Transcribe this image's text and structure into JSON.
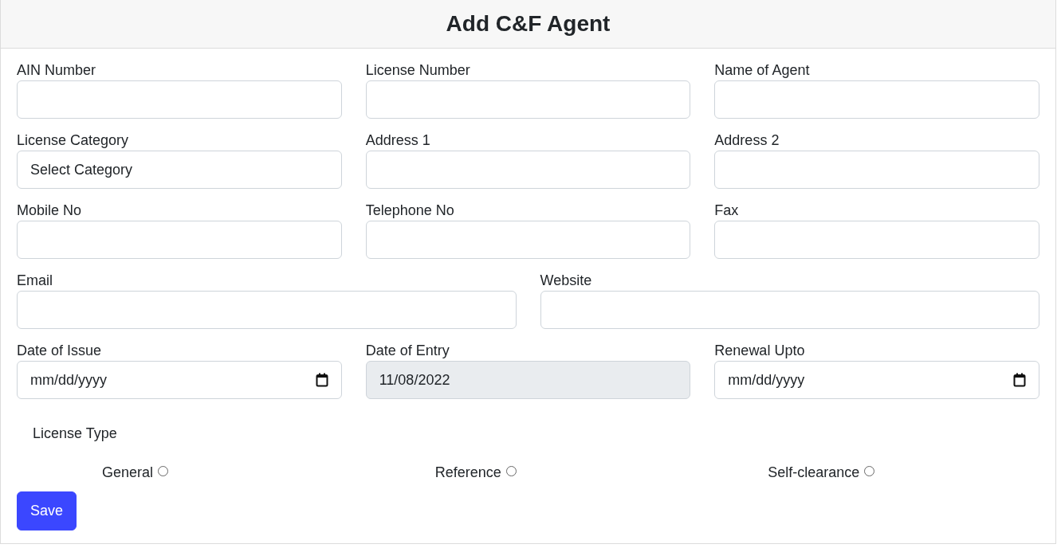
{
  "title": "Add C&F Agent",
  "rows": [
    {
      "fields": [
        {
          "kind": "text",
          "label": "AIN Number"
        },
        {
          "kind": "text",
          "label": "License Number"
        },
        {
          "kind": "text",
          "label": "Name of Agent"
        }
      ]
    },
    {
      "fields": [
        {
          "kind": "select",
          "label": "License Category",
          "value": "Select Category"
        },
        {
          "kind": "text",
          "label": "Address 1"
        },
        {
          "kind": "text",
          "label": "Address 2"
        }
      ]
    },
    {
      "fields": [
        {
          "kind": "text",
          "label": "Mobile No"
        },
        {
          "kind": "text",
          "label": "Telephone No"
        },
        {
          "kind": "text",
          "label": "Fax"
        }
      ]
    },
    {
      "fields": [
        {
          "kind": "text",
          "label": "Email"
        },
        {
          "kind": "text",
          "label": "Website"
        }
      ]
    },
    {
      "fields": [
        {
          "kind": "date",
          "label": "Date of Issue",
          "value": "mm/dd/yyyy",
          "disabled": false
        },
        {
          "kind": "date",
          "label": "Date of Entry",
          "value": "11/08/2022",
          "disabled": true
        },
        {
          "kind": "date",
          "label": "Renewal Upto",
          "value": "mm/dd/yyyy",
          "disabled": false
        }
      ]
    }
  ],
  "license_type": {
    "label": "License Type",
    "options": [
      {
        "label": "General",
        "selected": false
      },
      {
        "label": "Reference",
        "selected": false
      },
      {
        "label": "Self-clearance",
        "selected": false
      }
    ]
  },
  "save_button": "Save"
}
